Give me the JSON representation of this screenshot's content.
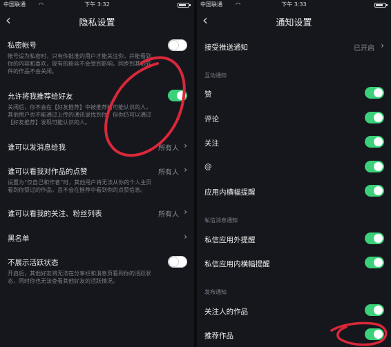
{
  "left": {
    "status": {
      "carrier": "中国联通",
      "time": "下午 3:32"
    },
    "nav": {
      "title": "隐私设置"
    },
    "private_account": {
      "title": "私密帐号",
      "desc": "帐号设为私密时，只有你批准的用户才能关注你，并能看到你的内容和喜欢，现有的粉丝不会受到影响，同步到其他软件的作品不会关闭。",
      "enabled": false
    },
    "recommend_friends": {
      "title": "允许将我推荐给好友",
      "desc": "关闭后，你不会在【好友推荐】中被推荐给可能认识的人，其他用户也不能通过上传的通讯录找到你，但你仍可以通过【好友推荐】发现可能认识的人。",
      "enabled": true
    },
    "who_can_message": {
      "title": "谁可以发消息给我",
      "value": "所有人"
    },
    "who_can_see_likes": {
      "title": "谁可以看我对作品的点赞",
      "value": "所有人",
      "desc": "设置为“仅自己和作者”时，其他用户将无法从你的个人主页看到你赞过的作品，且不会在推荐中看到你的点赞信息。"
    },
    "who_can_see_lists": {
      "title": "谁可以看我的关注、粉丝列表",
      "value": "所有人"
    },
    "blacklist": {
      "title": "黑名单"
    },
    "hide_activity": {
      "title": "不展示活跃状态",
      "desc": "开启后，其他好友将无法在分享栏和消息页看到你的活跃状态，同时你也无法查看其他好友的活跃情况。",
      "enabled": false
    }
  },
  "right": {
    "status": {
      "carrier": "中国联通",
      "time": "下午 3:33"
    },
    "nav": {
      "title": "通知设置"
    },
    "push": {
      "title": "接受推送通知",
      "value": "已开启"
    },
    "sections": {
      "interaction": "互动通知",
      "private_message": "私信消息通知",
      "publish": "发布通知"
    },
    "items": {
      "like": {
        "title": "赞",
        "enabled": true
      },
      "comment": {
        "title": "评论",
        "enabled": true
      },
      "follow": {
        "title": "关注",
        "enabled": true
      },
      "mention": {
        "title": "@",
        "enabled": true
      },
      "in_app_banner": {
        "title": "应用内横幅提醒",
        "enabled": true
      },
      "pm_out_app": {
        "title": "私信应用外提醒",
        "enabled": true
      },
      "pm_in_app_banner": {
        "title": "私信应用内横幅提醒",
        "enabled": true
      },
      "followed_works": {
        "title": "关注人的作品",
        "enabled": true
      },
      "recommended_works": {
        "title": "推荐作品",
        "enabled": true
      }
    }
  },
  "colors": {
    "toggle_on": "#3bd07a",
    "annotation": "#d9283a",
    "background": "#16171d"
  },
  "icons": [
    "back-chevron-icon",
    "chevron-right-icon",
    "wifi-icon",
    "battery-icon"
  ]
}
